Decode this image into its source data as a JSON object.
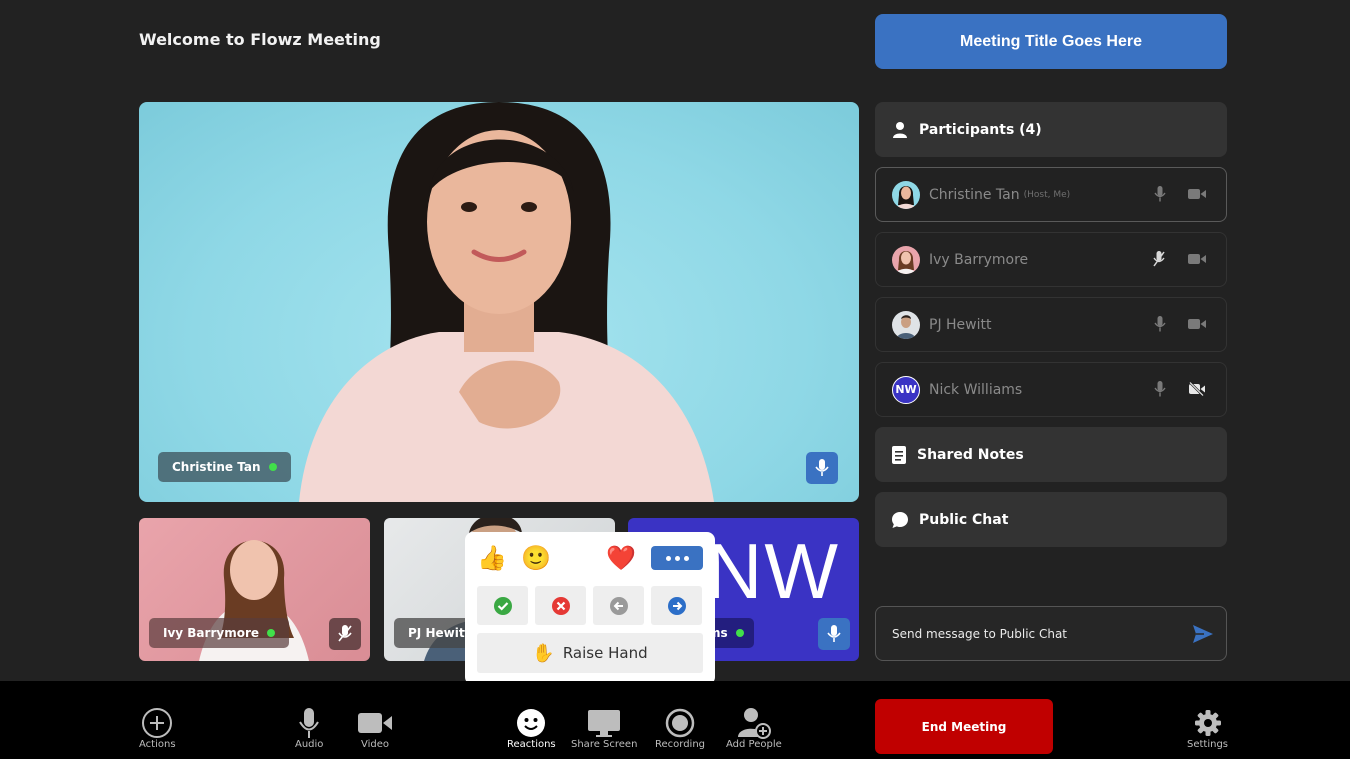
{
  "header": {
    "welcome": "Welcome to Flowz Meeting",
    "meeting_title": "Meeting Title Goes Here"
  },
  "main_video": {
    "name": "Christine Tan"
  },
  "thumbnails": [
    {
      "name": "Ivy Barrymore"
    },
    {
      "name": "PJ Hewitt"
    },
    {
      "name": "ms",
      "initials": "NW"
    }
  ],
  "sidebar": {
    "participants_label": "Participants (4)",
    "participants": [
      {
        "name": "Christine Tan",
        "role": "(Host, Me)"
      },
      {
        "name": "Ivy Barrymore",
        "role": ""
      },
      {
        "name": "PJ Hewitt",
        "role": ""
      },
      {
        "name": "Nick Williams",
        "role": "",
        "initials": "NW"
      }
    ],
    "shared_notes": "Shared Notes",
    "public_chat": "Public Chat",
    "chat_placeholder": "Send message to Public Chat"
  },
  "reactions": {
    "emojis": [
      "👍",
      "🙂",
      "😆",
      "❤️"
    ],
    "raise_hand": "Raise Hand",
    "raise_hand_emoji": "✋"
  },
  "toolbar": {
    "actions": "Actions",
    "audio": "Audio",
    "video": "Video",
    "reactions": "Reactions",
    "share_screen": "Share Screen",
    "recording": "Recording",
    "add_people": "Add People",
    "end_meeting": "End Meeting",
    "settings": "Settings"
  },
  "colors": {
    "accent": "#3a72c2",
    "danger": "#c00000",
    "online": "#41e04a",
    "background": "#222222"
  }
}
